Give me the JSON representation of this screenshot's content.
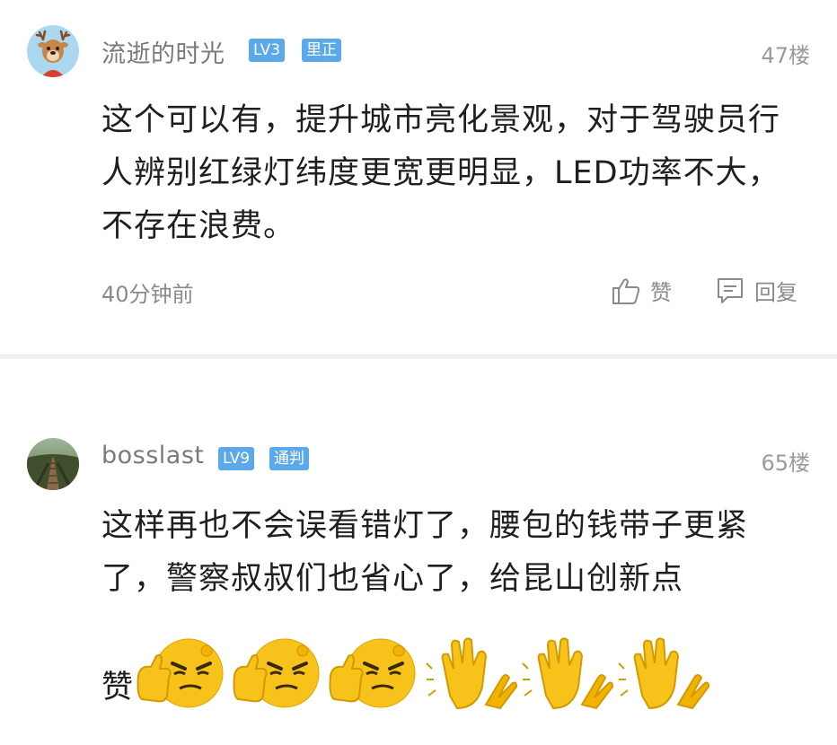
{
  "comments": [
    {
      "username": "流逝的时光",
      "level": "LV3",
      "role": "里正",
      "floor": "47楼",
      "content": "这个可以有，提升城市亮化景观，对于驾驶员行人辨别红绿灯纬度更宽更明显，LED功率不大，不存在浪费。",
      "time": "40分钟前",
      "like_label": "赞",
      "reply_label": "回复",
      "avatar_icon": "deer-avatar-icon"
    },
    {
      "username": "bosslast",
      "level": "LV9",
      "role": "通判",
      "floor": "65楼",
      "content": "这样再也不会误看错灯了，腰包的钱带子更紧了，警察叔叔们也省心了，给昆山创新点",
      "content_tail": "赞",
      "emojis": [
        "thumbs-up-face-emoji",
        "thumbs-up-face-emoji",
        "thumbs-up-face-emoji",
        "clapping-hands-emoji",
        "clapping-hands-emoji",
        "clapping-hands-emoji"
      ],
      "avatar_icon": "railway-avatar-icon"
    }
  ],
  "colors": {
    "badge": "#5ba8ea",
    "meta_text": "#8a8a8a",
    "content_text": "#1f1f1f",
    "emoji_yellow": "#f7c21a"
  }
}
